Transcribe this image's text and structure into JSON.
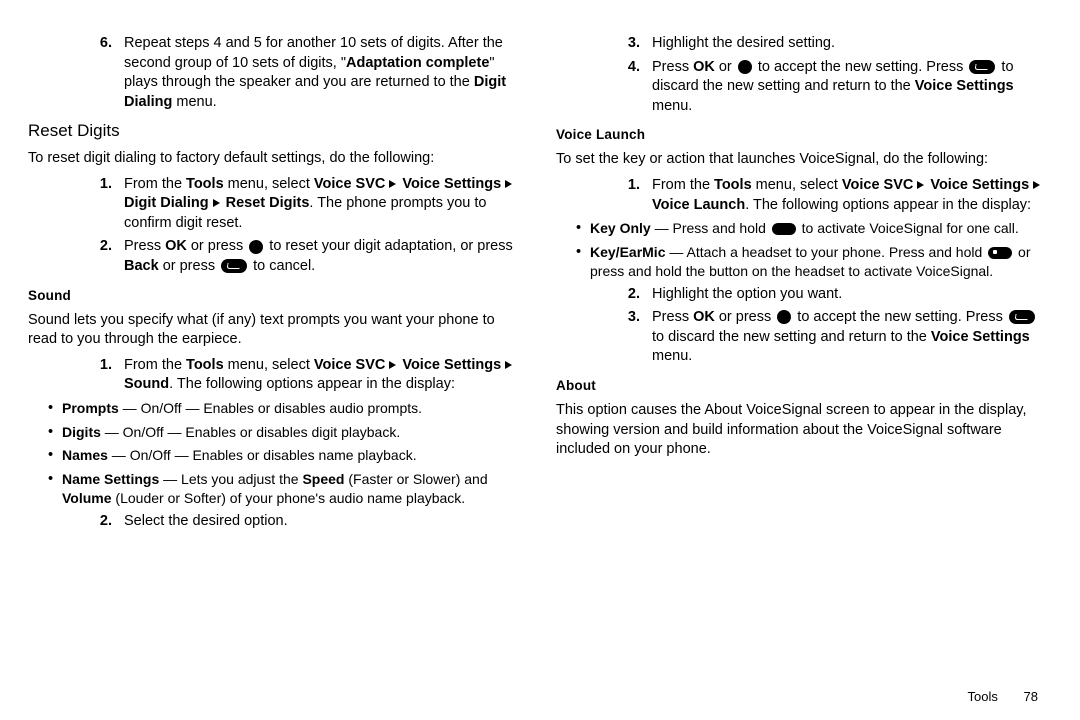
{
  "left": {
    "item6_num": "6.",
    "item6_a": "Repeat steps 4 and 5 for another 10 sets of digits. After the second group of 10 sets of digits, \"",
    "item6_b": "Adaptation complete",
    "item6_c": "\" plays through the speaker and you are returned to the ",
    "item6_d": "Digit Dialing",
    "item6_e": " menu.",
    "subhead1": "Reset Digits",
    "reset_intro": "To reset digit dialing to factory default settings, do the following:",
    "r1_num": "1.",
    "r1_a": "From the ",
    "r1_b": "Tools",
    "r1_c": " menu, select ",
    "r1_d": "Voice SVC",
    "r1_e": "Voice Settings",
    "r1_f": "Digit Dialing",
    "r1_g": "Reset Digits",
    "r1_h": ". The phone prompts you to confirm digit reset.",
    "r2_num": "2.",
    "r2_a": "Press ",
    "r2_b": "OK",
    "r2_c": " or press ",
    "r2_d": " to reset your digit adaptation, or press ",
    "r2_e": "Back",
    "r2_f": " or press ",
    "r2_g": " to cancel.",
    "h_sound": "Sound",
    "sound_intro": "Sound lets you specify what (if any) text prompts you want your phone to read to you through the earpiece.",
    "s1_num": "1.",
    "s1_a": "From the ",
    "s1_b": "Tools",
    "s1_c": " menu, select ",
    "s1_d": "Voice SVC",
    "s1_e": "Voice Settings",
    "s1_f": "Sound",
    "s1_g": ". The following options appear in the display:",
    "sb1_a": "Prompts",
    "sb1_b": " — On/Off — Enables or disables audio prompts.",
    "sb2_a": "Digits",
    "sb2_b": " — On/Off — Enables or disables digit playback.",
    "sb3_a": "Names",
    "sb3_b": " — On/Off — Enables or disables name playback.",
    "sb4_a": "Name Settings",
    "sb4_b": " — Lets you adjust the ",
    "sb4_c": "Speed",
    "sb4_d": " (Faster or Slower) and ",
    "sb4_e": "Volume",
    "sb4_f": " (Louder or Softer) of your phone's audio name playback.",
    "s2_num": "2.",
    "s2_a": "Select the desired option."
  },
  "right": {
    "r3_num": "3.",
    "r3_a": "Highlight the desired setting.",
    "r4_num": "4.",
    "r4_a": "Press ",
    "r4_b": "OK",
    "r4_c": " or ",
    "r4_d": " to accept the new setting. Press ",
    "r4_e": " to discard the new setting and return to the ",
    "r4_f": "Voice Settings",
    "r4_g": " menu.",
    "h_vl": "Voice Launch",
    "vl_intro": "To set the key or action that launches VoiceSignal, do the following:",
    "v1_num": "1.",
    "v1_a": "From the ",
    "v1_b": "Tools",
    "v1_c": " menu, select ",
    "v1_d": "Voice SVC",
    "v1_e": "Voice Settings",
    "v1_f": "Voice Launch",
    "v1_g": ". The following options appear in the display:",
    "vb1_a": "Key Only",
    "vb1_b": " — Press and hold ",
    "vb1_c": " to activate VoiceSignal for one call.",
    "vb2_a": "Key/EarMic",
    "vb2_b": " — Attach a headset to your phone. Press and hold ",
    "vb2_c": " or press and hold the button on the headset to activate VoiceSignal.",
    "v2_num": "2.",
    "v2_a": "Highlight the option you want.",
    "v3_num": "3.",
    "v3_a": "Press ",
    "v3_b": "OK",
    "v3_c": " or press ",
    "v3_d": " to accept the new setting. Press ",
    "v3_e": " to discard the new setting and return to the ",
    "v3_f": "Voice Settings",
    "v3_g": " menu.",
    "h_about": "About",
    "about_text": "This option causes the About VoiceSignal screen to appear in the display, showing version and build information about the VoiceSignal software included on your phone."
  },
  "footer": {
    "section": "Tools",
    "page": "78"
  }
}
